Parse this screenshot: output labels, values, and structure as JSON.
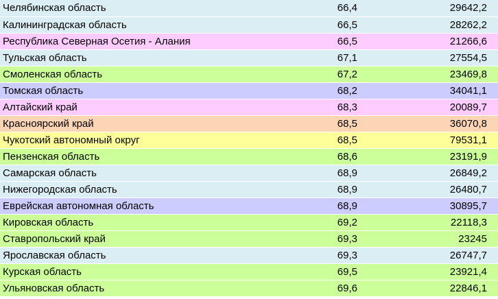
{
  "palette": {
    "light-blue": "#daeef3",
    "pink": "#ffccff",
    "green": "#ccff99",
    "lavender": "#ccccff",
    "peach": "#fcd5b4",
    "yellow": "#ffff99"
  },
  "rows": [
    {
      "name": "Челябинская область",
      "value": "66,4",
      "amount": "29642,2",
      "color": "light-blue"
    },
    {
      "name": "Калининградская область",
      "value": "66,5",
      "amount": "28262,2",
      "color": "light-blue"
    },
    {
      "name": "Республика Северная Осетия - Алания",
      "value": "66,5",
      "amount": "21266,6",
      "color": "pink"
    },
    {
      "name": "Тульская область",
      "value": "67,1",
      "amount": "27554,5",
      "color": "light-blue"
    },
    {
      "name": "Смоленская область",
      "value": "67,2",
      "amount": "23469,8",
      "color": "green"
    },
    {
      "name": "Томская область",
      "value": "68,2",
      "amount": "34041,1",
      "color": "lavender"
    },
    {
      "name": "Алтайский край",
      "value": "68,3",
      "amount": "20089,7",
      "color": "pink"
    },
    {
      "name": "Красноярский край",
      "value": "68,5",
      "amount": "36070,8",
      "color": "peach"
    },
    {
      "name": "Чукотский автономный округ",
      "value": "68,5",
      "amount": "79531,1",
      "color": "yellow"
    },
    {
      "name": "Пензенская область",
      "value": "68,6",
      "amount": "23191,9",
      "color": "green"
    },
    {
      "name": "Самарская область",
      "value": "68,9",
      "amount": "26849,2",
      "color": "light-blue"
    },
    {
      "name": "Нижегородская область",
      "value": "68,9",
      "amount": "26480,7",
      "color": "light-blue"
    },
    {
      "name": "Еврейская автономная область",
      "value": "68,9",
      "amount": "30895,7",
      "color": "lavender"
    },
    {
      "name": "Кировская область",
      "value": "69,2",
      "amount": "22118,3",
      "color": "green"
    },
    {
      "name": "Ставропольский край",
      "value": "69,3",
      "amount": "23245",
      "color": "green"
    },
    {
      "name": "Ярославская область",
      "value": "69,3",
      "amount": "26747,7",
      "color": "light-blue"
    },
    {
      "name": "Курская область",
      "value": "69,5",
      "amount": "23921,4",
      "color": "green"
    },
    {
      "name": "Ульяновская область",
      "value": "69,6",
      "amount": "22846,1",
      "color": "green"
    }
  ]
}
